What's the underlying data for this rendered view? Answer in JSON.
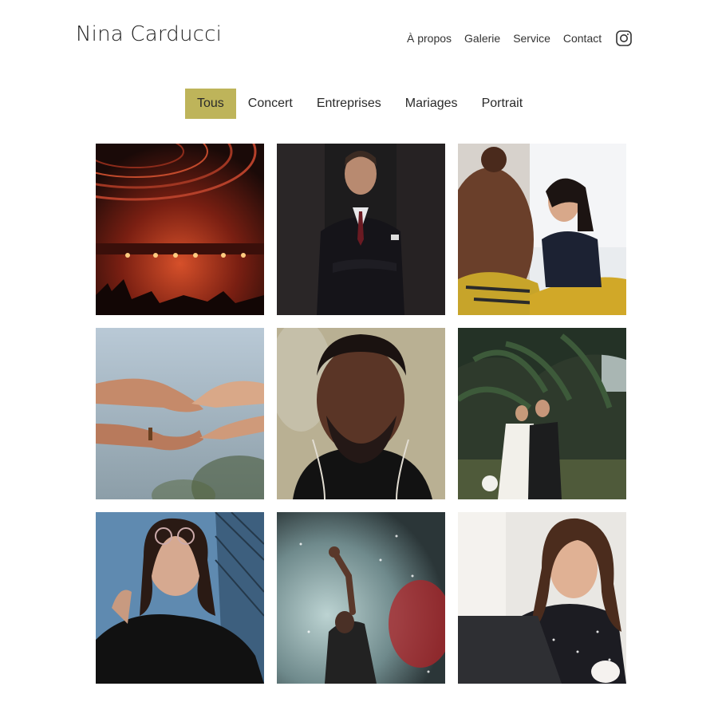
{
  "header": {
    "brand": "Nina Carducci",
    "nav": [
      "À propos",
      "Galerie",
      "Service",
      "Contact"
    ],
    "social_icon": "instagram-icon"
  },
  "filters": {
    "items": [
      "Tous",
      "Concert",
      "Entreprises",
      "Mariages",
      "Portrait"
    ],
    "active": "Tous",
    "active_color": "#beb45a"
  },
  "gallery": {
    "items": [
      {
        "category": "Concert",
        "subject": "concert-stage"
      },
      {
        "category": "Entreprises",
        "subject": "businessman-suit"
      },
      {
        "category": "Entreprises",
        "subject": "meeting-smiling-woman"
      },
      {
        "category": "Mariages",
        "subject": "reaching-hands"
      },
      {
        "category": "Portrait",
        "subject": "man-portrait"
      },
      {
        "category": "Mariages",
        "subject": "wedding-couple"
      },
      {
        "category": "Portrait",
        "subject": "woman-glasses-portrait"
      },
      {
        "category": "Concert",
        "subject": "concert-raised-hand"
      },
      {
        "category": "Entreprises",
        "subject": "woman-laptop-laughing"
      }
    ]
  }
}
